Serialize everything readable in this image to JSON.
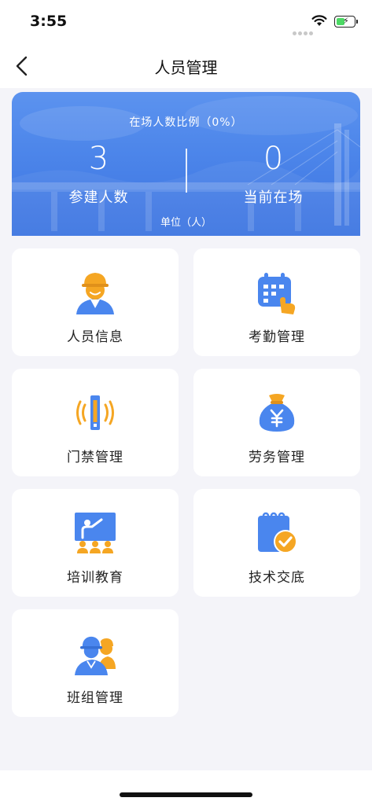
{
  "status": {
    "time": "3:55"
  },
  "nav": {
    "title": "人员管理",
    "back_label": ""
  },
  "summary": {
    "ratio_label": "在场人数比例（0%）",
    "total_value": "3",
    "total_label": "参建人数",
    "current_value": "0",
    "current_label": "当前在场",
    "unit_label": "单位（人）"
  },
  "tiles": [
    {
      "label": "人员信息",
      "icon": "worker-helmet-icon"
    },
    {
      "label": "考勤管理",
      "icon": "calendar-tap-icon"
    },
    {
      "label": "门禁管理",
      "icon": "access-gate-icon"
    },
    {
      "label": "劳务管理",
      "icon": "money-bag-icon"
    },
    {
      "label": "培训教育",
      "icon": "training-board-icon"
    },
    {
      "label": "技术交底",
      "icon": "notepad-check-icon"
    },
    {
      "label": "班组管理",
      "icon": "team-workers-icon"
    }
  ],
  "colors": {
    "primary": "#4f86ea",
    "accent": "#f5a623",
    "background": "#f4f4f9"
  }
}
